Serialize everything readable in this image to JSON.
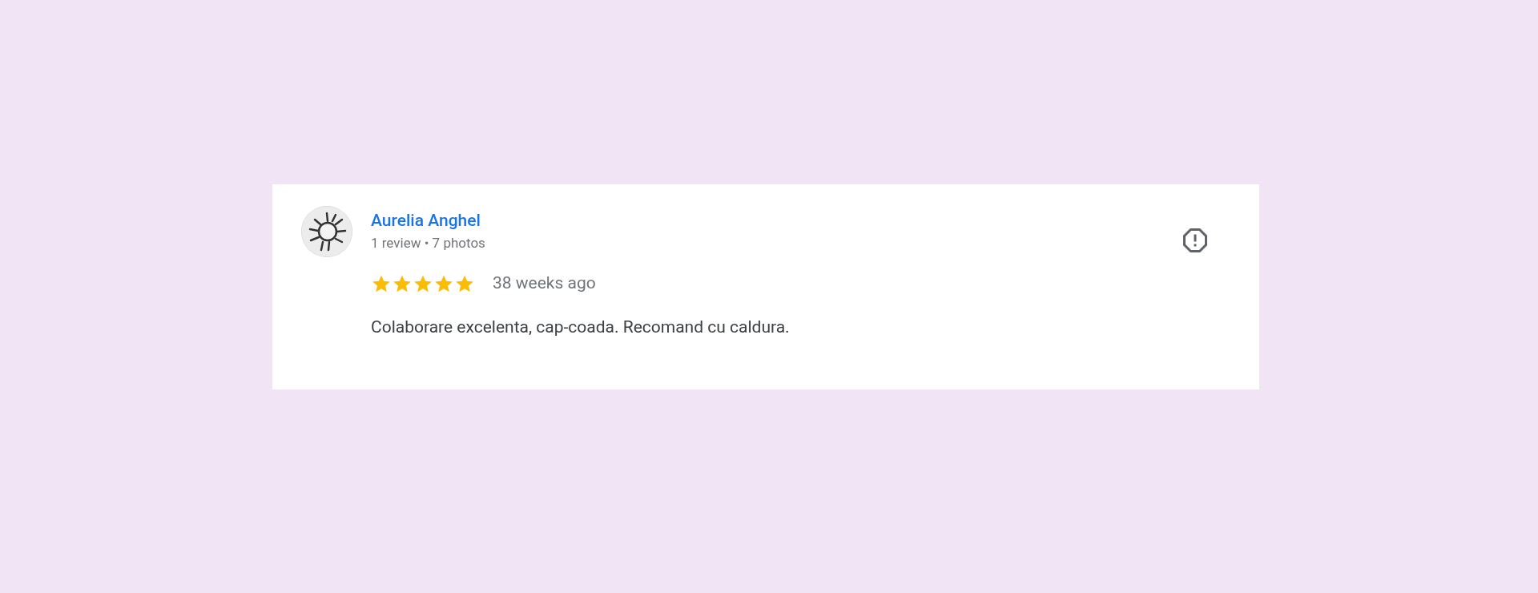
{
  "review": {
    "author": "Aurelia Anghel",
    "meta": "1 review • 7 photos",
    "stars": 5,
    "time": "38 weeks ago",
    "text": "Colaborare excelenta, cap-coada. Recomand cu caldura."
  }
}
